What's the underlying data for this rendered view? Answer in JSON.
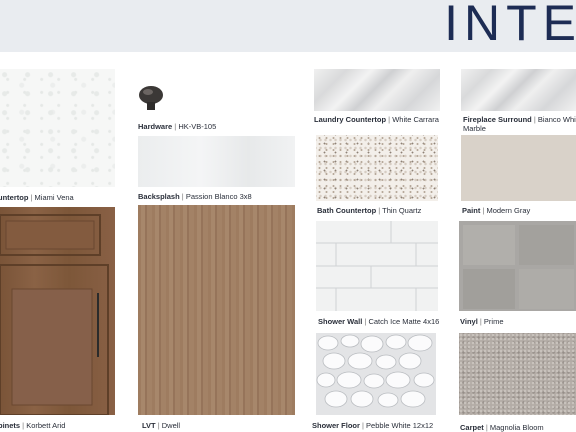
{
  "header": {
    "title": "INTE"
  },
  "colors": {
    "title": "#1d2c54",
    "band": "#e9ecf0"
  },
  "materials": [
    {
      "key": "kitchen_countertop",
      "label": "untertop",
      "value": "Miami Vena"
    },
    {
      "key": "hardware",
      "label": "Hardware",
      "value": "HK-VB-105"
    },
    {
      "key": "backsplash",
      "label": "Backsplash",
      "value": "Passion Blanco 3x8"
    },
    {
      "key": "cabinets",
      "label": "binets",
      "value": "Korbett Arid"
    },
    {
      "key": "lvt",
      "label": "LVT",
      "value": "Dwell"
    },
    {
      "key": "laundry_countertop",
      "label": "Laundry Countertop",
      "value": "White Carrara"
    },
    {
      "key": "bath_countertop",
      "label": "Bath Countertop",
      "value": "Thin Quartz"
    },
    {
      "key": "shower_wall",
      "label": "Shower Wall",
      "value": "Catch Ice Matte 4x16"
    },
    {
      "key": "shower_floor",
      "label": "Shower Floor",
      "value": "Pebble White 12x12"
    },
    {
      "key": "fireplace_surround",
      "label": "Fireplace Surround",
      "value": "Bianco Whi",
      "value_line2": "Marble"
    },
    {
      "key": "paint",
      "label": "Paint",
      "value": "Modern Gray"
    },
    {
      "key": "vinyl",
      "label": "Vinyl",
      "value": "Prime"
    },
    {
      "key": "carpet",
      "label": "Carpet",
      "value": "Magnolia Bloom"
    }
  ]
}
